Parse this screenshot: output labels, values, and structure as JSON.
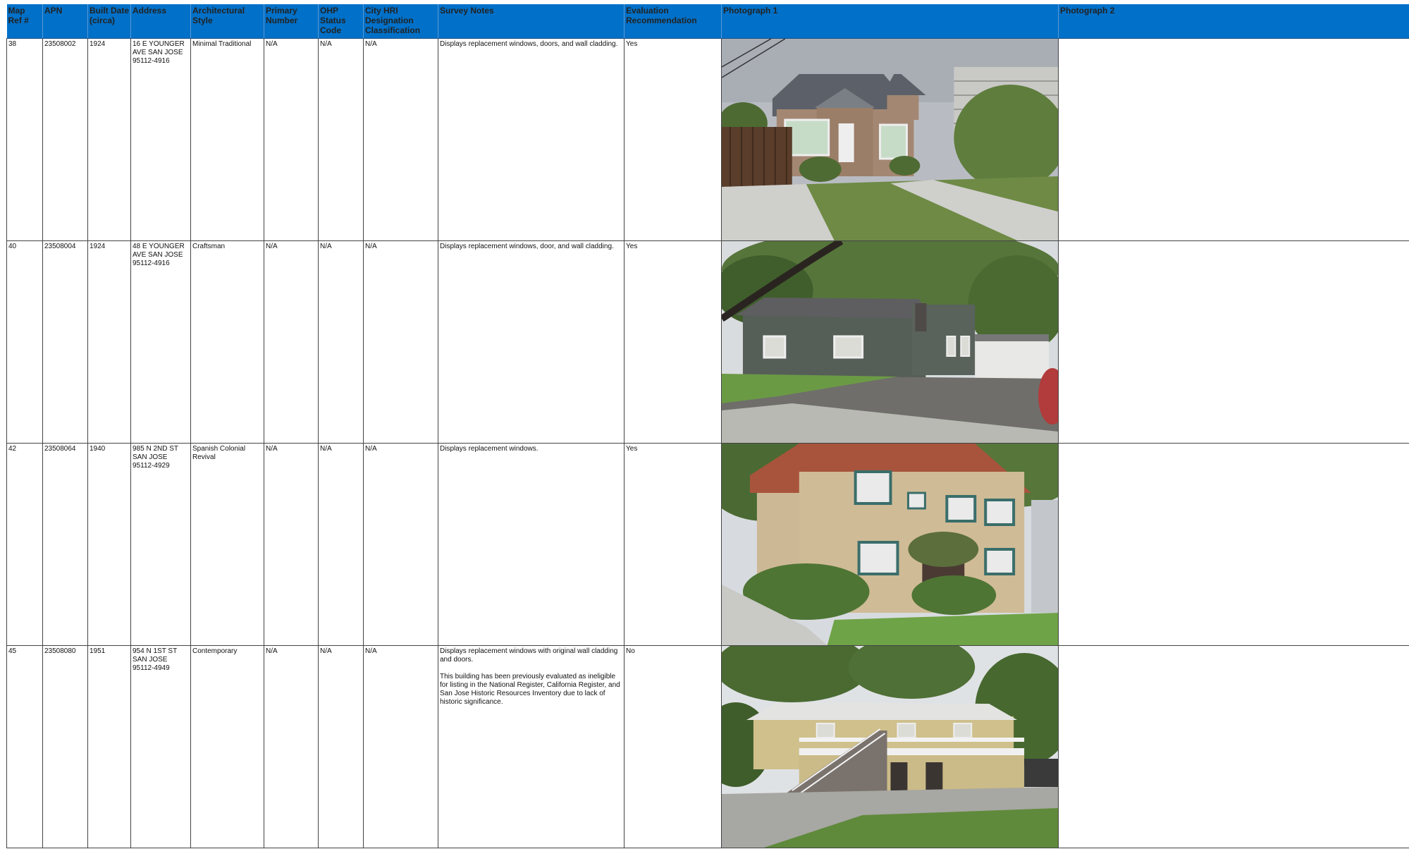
{
  "headers": {
    "map_ref": "Map Ref #",
    "apn": "APN",
    "built_date": "Built Date (circa)",
    "address": "Address",
    "arch_style": "Architectural Style",
    "primary_number": "Primary Number",
    "ohp_status": "OHP Status Code",
    "city_hri": "City HRI Designation Classification",
    "survey_notes": "Survey Notes",
    "evaluation": "Evaluation Recommendation",
    "photo1": "Photograph 1",
    "photo2": "Photograph 2"
  },
  "rows": [
    {
      "map_ref": "38",
      "apn": "23508002",
      "built_date": "1924",
      "address": "16 E YOUNGER AVE SAN JOSE 95112-4916",
      "arch_style": "Minimal Traditional",
      "primary_number": "N/A",
      "ohp_status": "N/A",
      "city_hri": "N/A",
      "survey_notes": [
        "Displays replacement windows, doors, and wall cladding."
      ],
      "evaluation": "Yes"
    },
    {
      "map_ref": "40",
      "apn": "23508004",
      "built_date": "1924",
      "address": "48 E YOUNGER AVE SAN JOSE 95112-4916",
      "arch_style": "Craftsman",
      "primary_number": "N/A",
      "ohp_status": "N/A",
      "city_hri": "N/A",
      "survey_notes": [
        "Displays replacement windows, door, and wall cladding."
      ],
      "evaluation": "Yes"
    },
    {
      "map_ref": "42",
      "apn": "23508064",
      "built_date": "1940",
      "address": "985 N 2ND ST SAN JOSE 95112-4929",
      "arch_style": "Spanish Colonial Revival",
      "primary_number": "N/A",
      "ohp_status": "N/A",
      "city_hri": "N/A",
      "survey_notes": [
        "Displays replacement windows."
      ],
      "evaluation": "Yes"
    },
    {
      "map_ref": "45",
      "apn": "23508080",
      "built_date": "1951",
      "address": "954 N 1ST ST SAN JOSE 95112-4949",
      "arch_style": "Contemporary",
      "primary_number": "N/A",
      "ohp_status": "N/A",
      "city_hri": "N/A",
      "survey_notes": [
        "Displays replacement windows with original wall cladding and doors.",
        "This building has been previously evaluated as ineligible for listing in the National Register, California Register, and San Jose Historic Resources Inventory due to lack of historic significance."
      ],
      "evaluation": "No"
    }
  ]
}
